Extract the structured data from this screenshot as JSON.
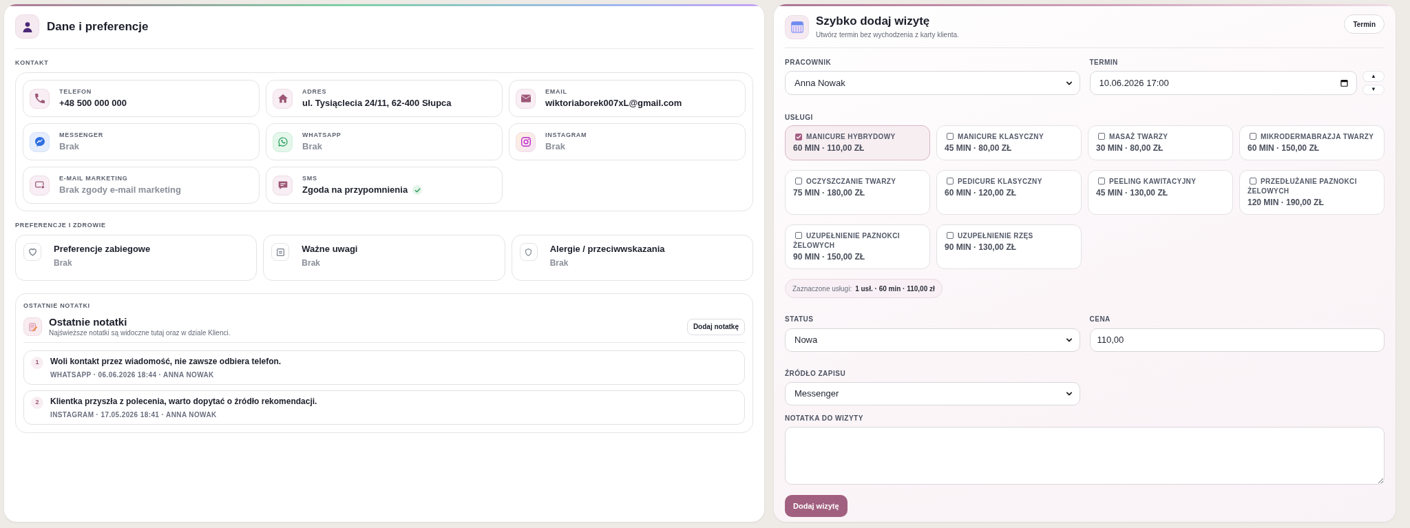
{
  "profile": {
    "title": "Dane i preferencje",
    "contact": {
      "heading": "KONTAKT",
      "items": [
        {
          "kind": "phone",
          "label": "TELEFON",
          "value": "+48 500 000 000",
          "empty": false,
          "confirmed": false
        },
        {
          "kind": "address",
          "label": "ADRES",
          "value": "ul. Tysiąclecia 24/11, 62-400 Słupca",
          "empty": false,
          "confirmed": false
        },
        {
          "kind": "email",
          "label": "EMAIL",
          "value": "wiktoriaborek007xL@gmail.com",
          "empty": false,
          "confirmed": false
        },
        {
          "kind": "messenger",
          "label": "MESSENGER",
          "value": "Brak",
          "empty": true,
          "confirmed": false
        },
        {
          "kind": "whatsapp",
          "label": "WHATSAPP",
          "value": "Brak",
          "empty": true,
          "confirmed": false
        },
        {
          "kind": "instagram",
          "label": "INSTAGRAM",
          "value": "Brak",
          "empty": true,
          "confirmed": false
        },
        {
          "kind": "marketing",
          "label": "E-MAIL MARKETING",
          "value": "Brak zgody e-mail marketing",
          "empty": true,
          "confirmed": false
        },
        {
          "kind": "sms",
          "label": "SMS",
          "value": "Zgoda na przypomnienia",
          "empty": false,
          "confirmed": true
        }
      ]
    },
    "preferences": {
      "heading": "PREFERENCJE I ZDROWIE",
      "items": [
        {
          "kind": "preferences",
          "title": "Preferencje zabiegowe",
          "value": "Brak",
          "empty": true
        },
        {
          "kind": "notes",
          "title": "Ważne uwagi",
          "value": "Brak",
          "empty": true
        },
        {
          "kind": "allergies",
          "title": "Alergie / przeciwwskazania",
          "value": "Brak",
          "empty": true
        }
      ]
    },
    "notes": {
      "heading": "OSTATNIE NOTATKI",
      "title": "Ostatnie notatki",
      "subtitle": "Najświeższe notatki są widoczne tutaj oraz w dziale Klienci.",
      "add_button": "Dodaj notatkę",
      "items": [
        {
          "number": "1",
          "text": "Woli kontakt przez wiadomość, nie zawsze odbiera telefon.",
          "meta": "WHATSAPP · 06.06.2026 18:44 · ANNA NOWAK"
        },
        {
          "number": "2",
          "text": "Klientka przyszła z polecenia, warto dopytać o źródło rekomendacji.",
          "meta": "INSTAGRAM · 17.05.2026 18:41 · ANNA NOWAK"
        }
      ]
    }
  },
  "quick_add": {
    "title": "Szybko dodaj wizytę",
    "subtitle": "Utwórz termin bez wychodzenia z karty klienta.",
    "header_button": "Termin",
    "employee": {
      "label": "PRACOWNIK",
      "value": "Anna Nowak"
    },
    "date": {
      "label": "TERMIN",
      "value": "10.06.2026 17:00",
      "stepper": [
        "▲",
        "▼"
      ]
    },
    "services": {
      "heading": "USŁUGI",
      "items": [
        {
          "name": "MANICURE HYBRYDOWY",
          "details": "60 MIN · 110,00 ZŁ",
          "selected": true
        },
        {
          "name": "MANICURE KLASYCZNY",
          "details": "45 MIN · 80,00 ZŁ",
          "selected": false
        },
        {
          "name": "MASAŻ TWARZY",
          "details": "30 MIN · 80,00 ZŁ",
          "selected": false
        },
        {
          "name": "MIKRODERMABRAZJA TWARZY",
          "details": "60 MIN · 150,00 ZŁ",
          "selected": false
        },
        {
          "name": "OCZYSZCZANIE TWARZY",
          "details": "75 MIN · 180,00 ZŁ",
          "selected": false
        },
        {
          "name": "PEDICURE KLASYCZNY",
          "details": "60 MIN · 120,00 ZŁ",
          "selected": false
        },
        {
          "name": "PEELING KAWITACYJNY",
          "details": "45 MIN · 130,00 ZŁ",
          "selected": false
        },
        {
          "name": "PRZEDŁUŻANIE PAZNOKCI ŻELOWYCH",
          "details": "120 MIN · 190,00 ZŁ",
          "selected": false
        },
        {
          "name": "UZUPEŁNIENIE PAZNOKCI ŻELOWYCH",
          "details": "90 MIN · 150,00 ZŁ",
          "selected": false
        },
        {
          "name": "UZUPEŁNIENIE RZĘS",
          "details": "90 MIN · 130,00 ZŁ",
          "selected": false
        }
      ],
      "summary": {
        "label": "Zaznaczone usługi:",
        "value": "1 usł. · 60 min · 110,00 zł"
      }
    },
    "status": {
      "label": "STATUS",
      "value": "Nowa"
    },
    "price": {
      "label": "CENA",
      "value": "110,00"
    },
    "source": {
      "label": "ŹRÓDŁO ZAPISU",
      "value": "Messenger"
    },
    "note": {
      "label": "NOTATKA DO WIZYTY"
    },
    "submit_button": "Dodaj wizytę"
  }
}
